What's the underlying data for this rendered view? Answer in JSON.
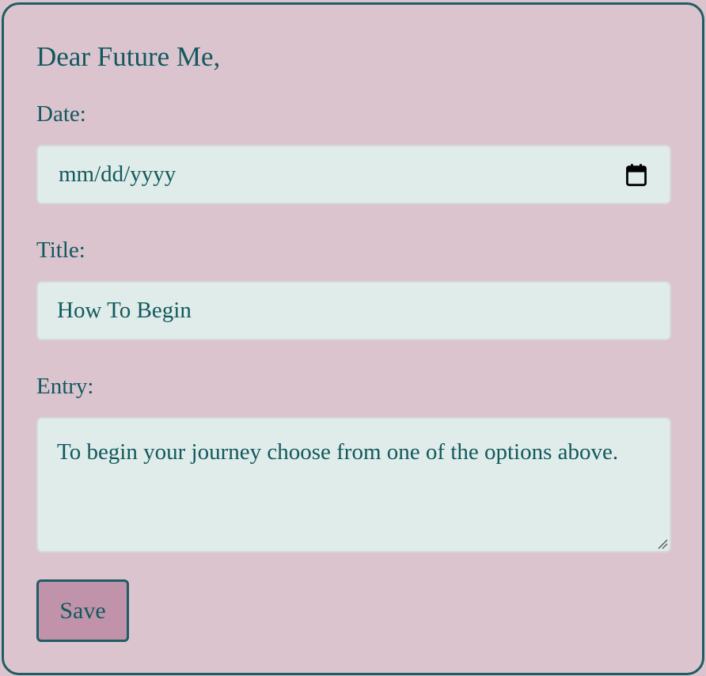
{
  "form": {
    "heading": "Dear Future Me,",
    "date_label": "Date:",
    "date_placeholder": "mm/dd/yyyy",
    "title_label": "Title:",
    "title_value": "How To Begin",
    "entry_label": "Entry:",
    "entry_value": "To begin your journey choose from one of the options above.",
    "save_label": "Save"
  },
  "colors": {
    "background": "#dcc4cf",
    "text": "#11595e",
    "border": "#1f5d64",
    "field_background": "#e0ece9",
    "button_background": "#c193ab"
  },
  "icons": {
    "date_picker": "calendar-icon",
    "entry_resize": "resize-grip-icon"
  }
}
